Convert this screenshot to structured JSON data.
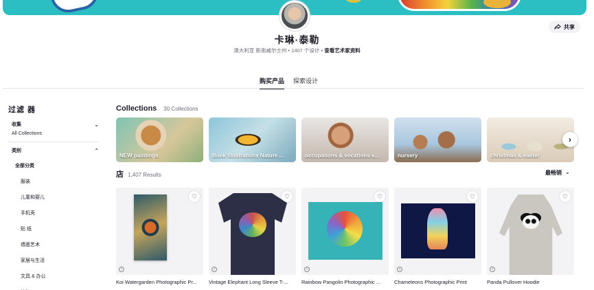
{
  "profile": {
    "name": "卡琳·泰勒",
    "location": "澳大利亚 新南威尔士州",
    "designs": "1407 个设计",
    "bio_link": "查看艺术家资料",
    "separator": "•",
    "share_label": "共享"
  },
  "tabs": [
    {
      "label": "购买产品",
      "active": true
    },
    {
      "label": "探索设计",
      "active": false
    }
  ],
  "filters": {
    "title": "过滤 器",
    "collection_group": "收集",
    "collection_value": "All Collections",
    "category_group": "类别",
    "category_all": "全部分类",
    "categories": [
      "服装",
      "儿童和婴儿",
      "手机壳",
      "贴 纸",
      "墙面艺术",
      "家居与生活",
      "文具 & 办公",
      "礼物"
    ]
  },
  "collections": {
    "title": "Collections",
    "count": "30 Collections",
    "items": [
      {
        "label": "NEW paintings"
      },
      {
        "label": "Book Illustrations Nature ..."
      },
      {
        "label": "occupations & vocations s..."
      },
      {
        "label": "nursery"
      },
      {
        "label": "christmas & easter"
      }
    ]
  },
  "shop": {
    "title": "店",
    "results": "1,407 Results",
    "sort_label": "最畅销",
    "products": [
      {
        "name": "Koi Watergarden Photographic Pr..."
      },
      {
        "name": "Vintage Elephant Long Sleeve T-..."
      },
      {
        "name": "Rainbow Pangolin Photographic ..."
      },
      {
        "name": "Chameleons Photographic Print"
      },
      {
        "name": "Panda Pullover Hoodie"
      }
    ]
  },
  "colors": {
    "banner": "#2bbfc4",
    "text": "#1c1c28",
    "muted": "#6b6b78"
  },
  "icons": {
    "share": "share-arrow-icon",
    "chevron": "chevron-down-icon",
    "next": "chevron-right-icon",
    "heart": "heart-icon",
    "info": "info-icon"
  }
}
